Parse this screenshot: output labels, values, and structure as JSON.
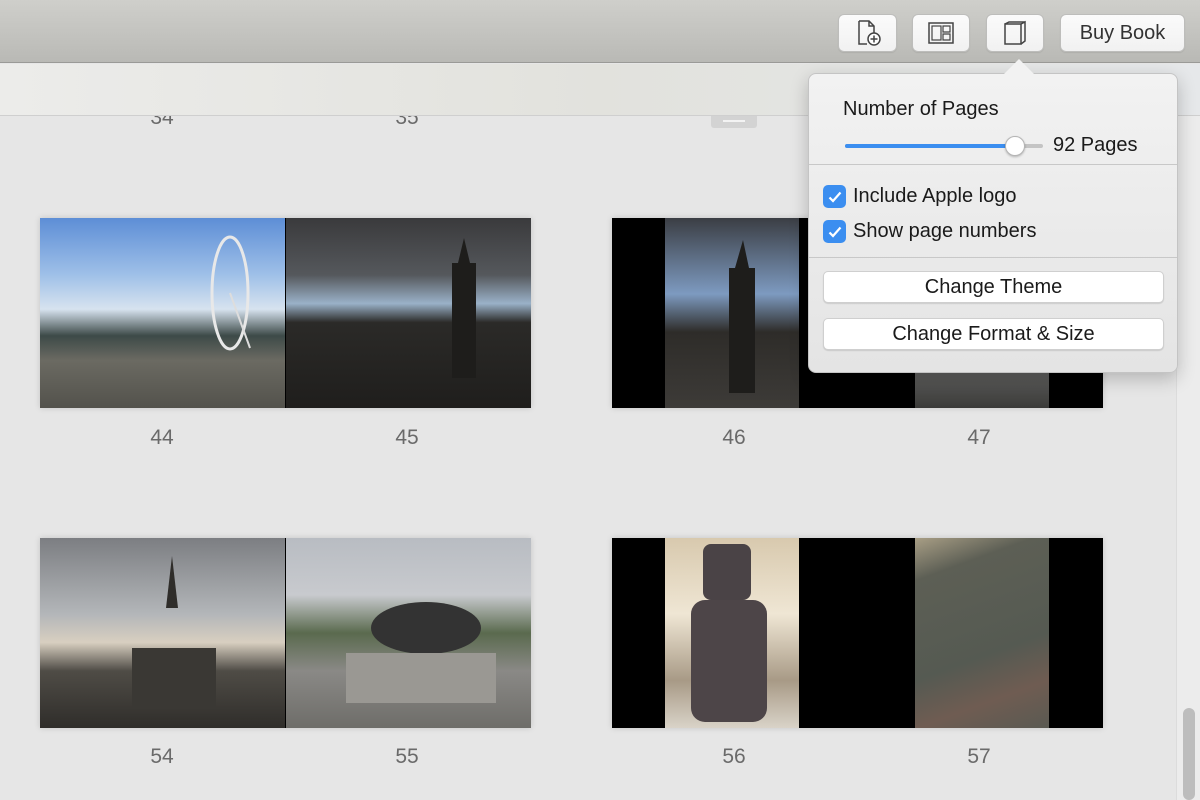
{
  "toolbar": {
    "add_page_button": {
      "icon": "add-page-icon"
    },
    "layout_button": {
      "icon": "layout-icon"
    },
    "book_settings_button": {
      "icon": "book-icon"
    },
    "buy_book_label": "Buy Book"
  },
  "popover": {
    "title": "Number of Pages",
    "pages_slider_fraction": 0.86,
    "pages_value_label": "92 Pages",
    "checkboxes": [
      {
        "label": "Include Apple logo",
        "checked": true
      },
      {
        "label": "Show page numbers",
        "checked": true
      }
    ],
    "buttons": [
      {
        "label": "Change Theme"
      },
      {
        "label": "Change Format & Size"
      }
    ],
    "accent_color": "#3b8ef0"
  },
  "pages": {
    "partial_top_numbers": [
      "34",
      "35"
    ],
    "spreads": [
      {
        "left": "44",
        "right": "45",
        "left_photo": "London Eye on the Thames",
        "right_photo": "Houses of Parliament and Big Ben"
      },
      {
        "left": "46",
        "right": "47",
        "left_photo": "Big Ben with scaffolding",
        "right_photo": "Monument"
      },
      {
        "left": "54",
        "right": "55",
        "left_photo": "St Martin-in-the-Fields church",
        "right_photo": "Trafalgar Square lion"
      },
      {
        "left": "56",
        "right": "57",
        "left_photo": "Moai statue",
        "right_photo": "Rosetta Stone"
      }
    ]
  }
}
